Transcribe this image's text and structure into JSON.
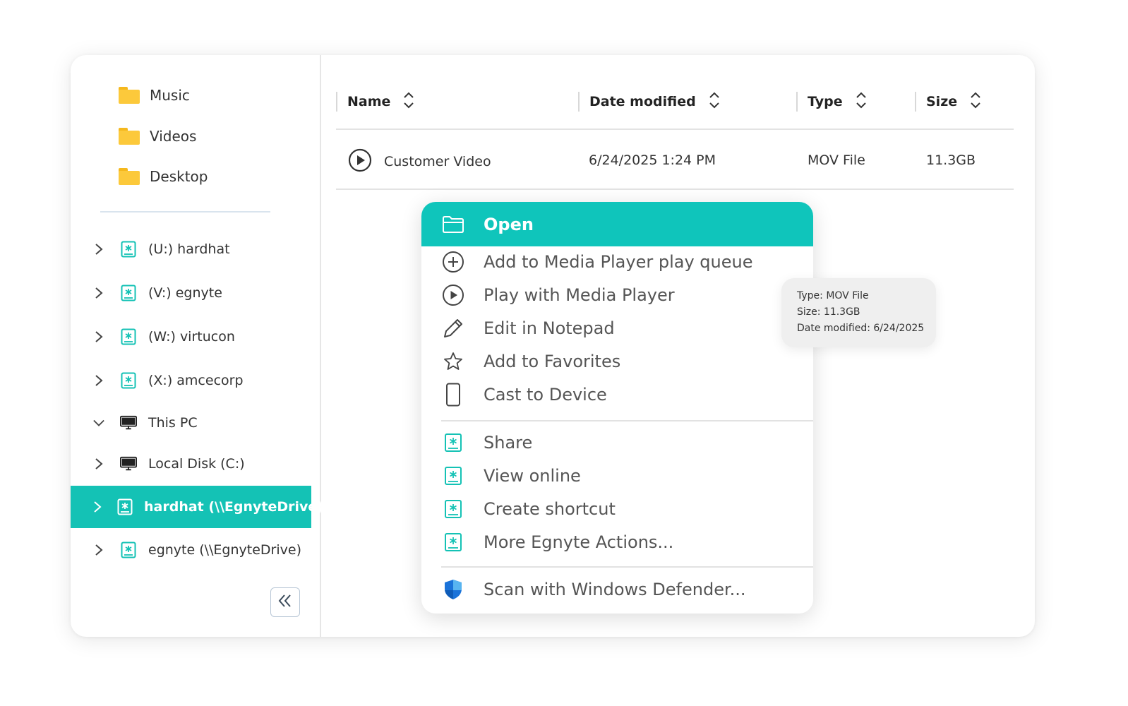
{
  "sidebar": {
    "folders": [
      {
        "label": "Music",
        "icon": "folder-icon"
      },
      {
        "label": "Videos",
        "icon": "folder-icon"
      },
      {
        "label": "Desktop",
        "icon": "folder-icon"
      }
    ],
    "tree": [
      {
        "label": "(U:) hardhat",
        "icon": "egnyte-drive-icon",
        "expanded": false,
        "selected": false
      },
      {
        "label": "(V:) egnyte",
        "icon": "egnyte-drive-icon",
        "expanded": false,
        "selected": false
      },
      {
        "label": "(W:) virtucon",
        "icon": "egnyte-drive-icon",
        "expanded": false,
        "selected": false
      },
      {
        "label": "(X:) amcecorp",
        "icon": "egnyte-drive-icon",
        "expanded": false,
        "selected": false
      },
      {
        "label": "This PC",
        "icon": "monitor-icon",
        "expanded": true,
        "selected": false
      },
      {
        "label": "Local Disk (C:)",
        "icon": "monitor-icon",
        "expanded": false,
        "selected": false
      },
      {
        "label": "hardhat (\\\\EgnyteDrive)",
        "icon": "egnyte-drive-icon",
        "expanded": false,
        "selected": true
      },
      {
        "label": "egnyte (\\\\EgnyteDrive)",
        "icon": "egnyte-drive-icon",
        "expanded": false,
        "selected": false
      }
    ],
    "collapse_icon": "double-chevron-left-icon"
  },
  "table": {
    "columns": [
      "Name",
      "Date modified",
      "Type",
      "Size"
    ],
    "rows": [
      {
        "name": "Customer Video",
        "date": "6/24/2025 1:24 PM",
        "type": "MOV File",
        "size": "11.3GB",
        "icon": "play-circle-icon"
      }
    ]
  },
  "context_menu": {
    "groups": [
      [
        {
          "label": "Open",
          "icon": "folder-open-icon",
          "active": true
        },
        {
          "label": "Add to Media Player play queue",
          "icon": "plus-circle-icon"
        },
        {
          "label": "Play with Media Player",
          "icon": "play-circle-icon"
        },
        {
          "label": "Edit in Notepad",
          "icon": "pencil-icon"
        },
        {
          "label": "Add to Favorites",
          "icon": "star-icon"
        },
        {
          "label": "Cast to Device",
          "icon": "phone-icon"
        }
      ],
      [
        {
          "label": "Share",
          "icon": "egnyte-icon"
        },
        {
          "label": "View online",
          "icon": "egnyte-icon"
        },
        {
          "label": "Create shortcut",
          "icon": "egnyte-icon"
        },
        {
          "label": "More Egnyte Actions...",
          "icon": "egnyte-icon"
        }
      ],
      [
        {
          "label": "Scan with Windows Defender...",
          "icon": "shield-icon"
        }
      ]
    ]
  },
  "tooltip": {
    "type": "Type: MOV File",
    "size": "Size: 11.3GB",
    "date": "Date modified: 6/24/2025"
  },
  "colors": {
    "accent": "#14c2b5",
    "menu_active": "#0fc5bb",
    "folder": "#fcc93b",
    "shield": "#1a73d9"
  }
}
